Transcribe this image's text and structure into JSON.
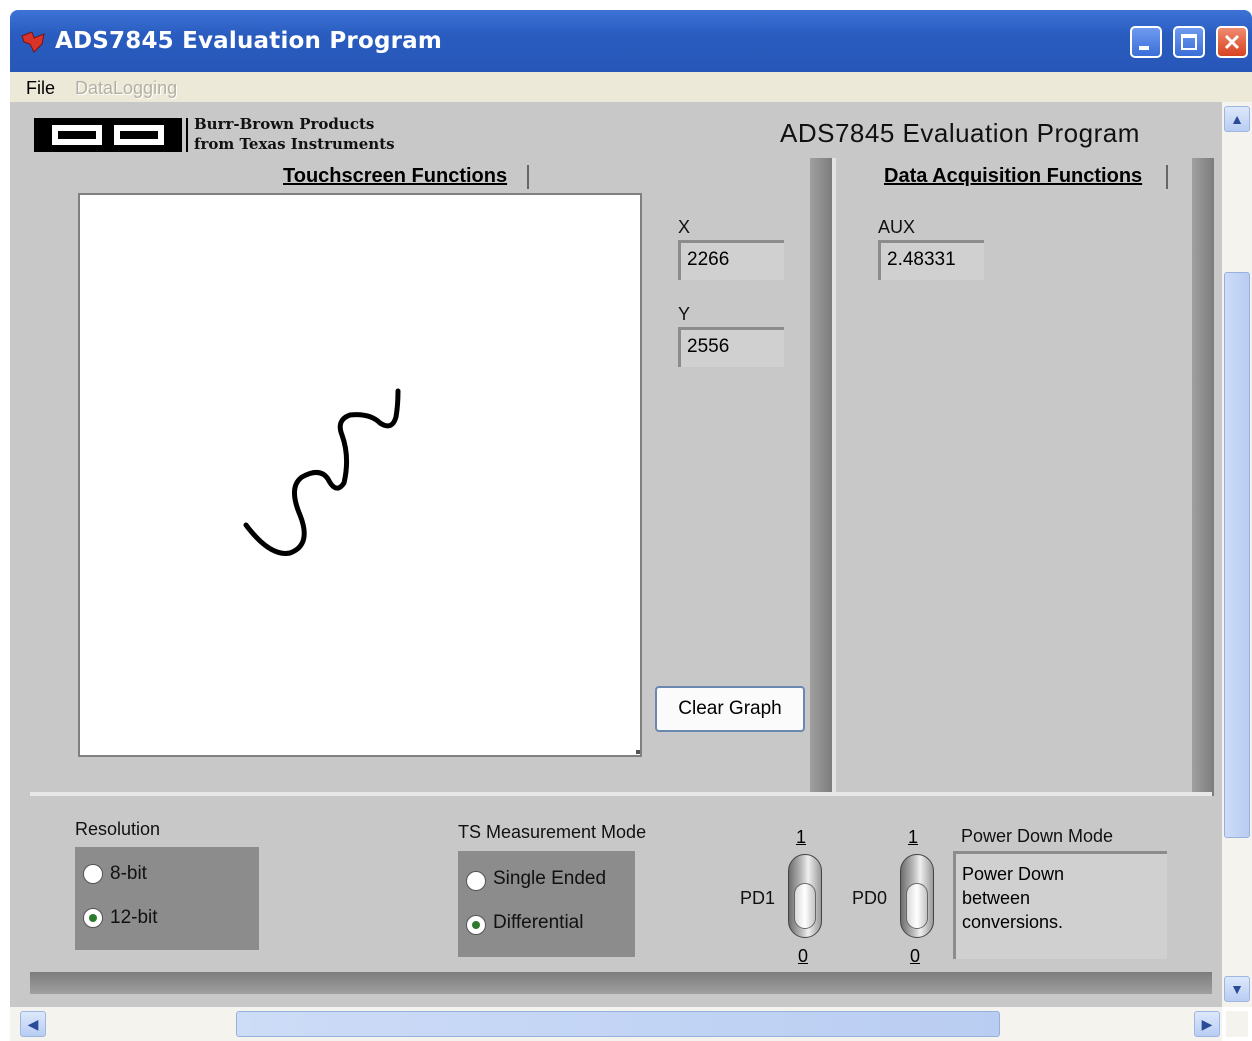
{
  "window": {
    "title": "ADS7845 Evaluation Program"
  },
  "menu": {
    "file": "File",
    "datalogging": "DataLogging"
  },
  "header": {
    "logo_line1": "Burr-Brown Products",
    "logo_line2": "from Texas Instruments",
    "title": "ADS7845 Evaluation Program"
  },
  "touchscreen": {
    "section_title": "Touchscreen Functions",
    "x_label": "X",
    "x_value": "2266",
    "y_label": "Y",
    "y_value": "2556",
    "clear_button": "Clear Graph"
  },
  "daq": {
    "section_title": "Data Acquisition Functions",
    "aux_label": "AUX",
    "aux_value": "2.48331"
  },
  "resolution": {
    "label": "Resolution",
    "options": [
      "8-bit",
      "12-bit"
    ],
    "selected": "12-bit"
  },
  "ts_mode": {
    "label": "TS Measurement Mode",
    "options": [
      "Single Ended",
      "Differential"
    ],
    "selected": "Differential"
  },
  "power": {
    "pd1_label": "PD1",
    "pd0_label": "PD0",
    "top_value": "1",
    "bottom_value": "0",
    "mode_label": "Power Down Mode",
    "mode_text_line1": "Power Down",
    "mode_text_line2": "between",
    "mode_text_line3": "conversions."
  },
  "colors": {
    "titlebar": "#2a5cc0",
    "panel": "#c8c8c8",
    "trace": "#000000"
  }
}
